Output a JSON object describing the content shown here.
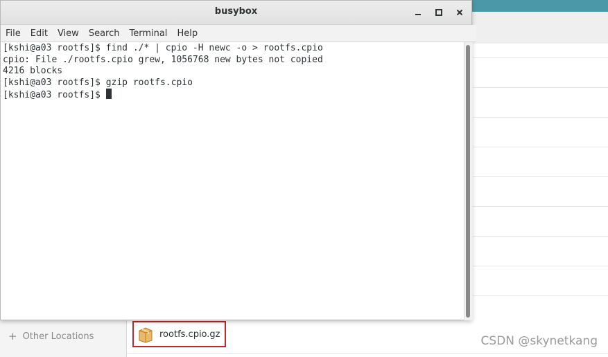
{
  "file_manager": {
    "sidebar": {
      "other_locations_label": "Other Locations"
    },
    "files": [
      {
        "name": "rootfs.cpio.gz"
      }
    ]
  },
  "terminal": {
    "title": "busybox",
    "window_buttons": {
      "minimize": "minimize-icon",
      "maximize": "maximize-icon",
      "close": "close-icon"
    },
    "menu": [
      "File",
      "Edit",
      "View",
      "Search",
      "Terminal",
      "Help"
    ],
    "lines": [
      "[kshi@a03 rootfs]$ find ./* | cpio -H newc -o > rootfs.cpio",
      "cpio: File ./rootfs.cpio grew, 1056768 new bytes not copied",
      "4216 blocks",
      "[kshi@a03 rootfs]$ gzip rootfs.cpio",
      "[kshi@a03 rootfs]$ "
    ]
  },
  "watermark": "CSDN @skynetkang",
  "colors": {
    "highlight_border": "#c0282d",
    "top_bar": "#4a98a8"
  }
}
